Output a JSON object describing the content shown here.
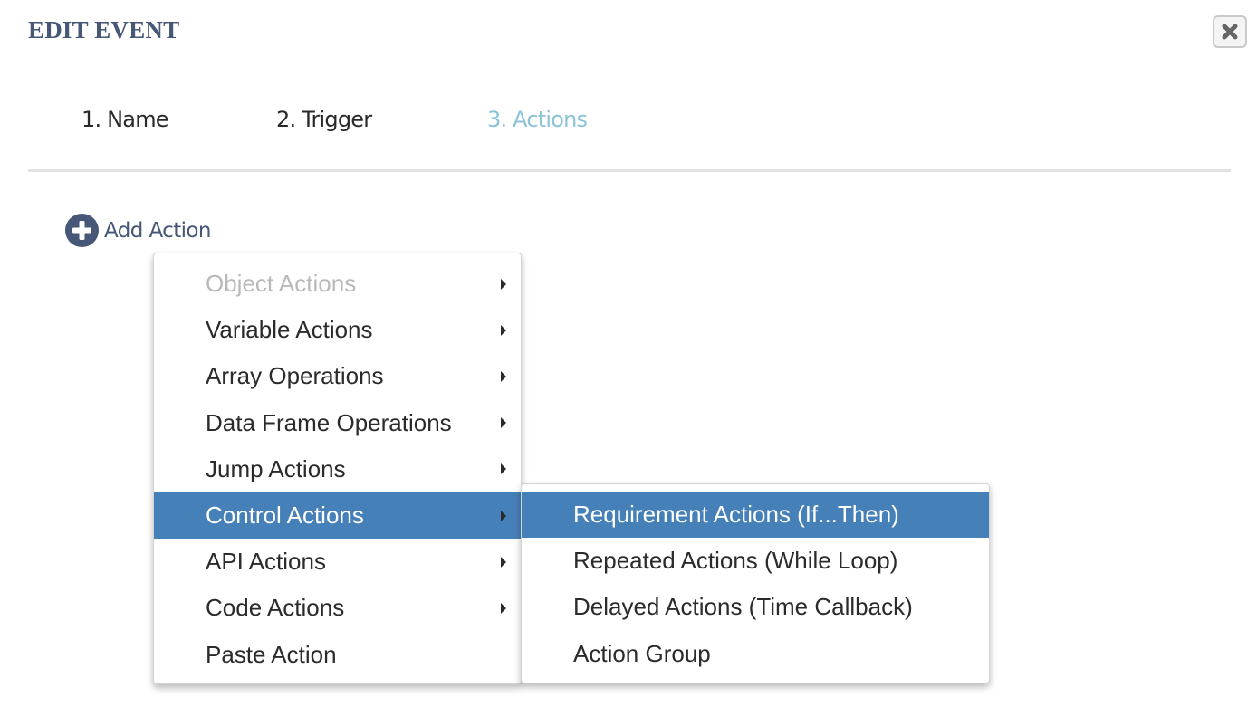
{
  "dialog": {
    "title": "EDIT EVENT",
    "close_icon": "close-x-icon"
  },
  "tabs": [
    {
      "label": "1. Name",
      "active": false
    },
    {
      "label": "2. Trigger",
      "active": false
    },
    {
      "label": "3. Actions",
      "active": true
    }
  ],
  "add_action": {
    "icon": "plus-circle-icon",
    "label": "Add Action"
  },
  "menu": {
    "items": [
      {
        "label": "Object Actions",
        "submenu": true,
        "disabled": true,
        "highlighted": false
      },
      {
        "label": "Variable Actions",
        "submenu": true,
        "disabled": false,
        "highlighted": false
      },
      {
        "label": "Array Operations",
        "submenu": true,
        "disabled": false,
        "highlighted": false
      },
      {
        "label": "Data Frame Operations",
        "submenu": true,
        "disabled": false,
        "highlighted": false
      },
      {
        "label": "Jump Actions",
        "submenu": true,
        "disabled": false,
        "highlighted": false
      },
      {
        "label": "Control Actions",
        "submenu": true,
        "disabled": false,
        "highlighted": true
      },
      {
        "label": "API Actions",
        "submenu": true,
        "disabled": false,
        "highlighted": false
      },
      {
        "label": "Code Actions",
        "submenu": true,
        "disabled": false,
        "highlighted": false
      },
      {
        "label": "Paste Action",
        "submenu": false,
        "disabled": false,
        "highlighted": false
      }
    ]
  },
  "submenu": {
    "parent": "Control Actions",
    "items": [
      {
        "label": "Requirement Actions (If...Then)",
        "highlighted": true
      },
      {
        "label": "Repeated Actions (While Loop)",
        "highlighted": false
      },
      {
        "label": "Delayed Actions (Time Callback)",
        "highlighted": false
      },
      {
        "label": "Action Group",
        "highlighted": false
      }
    ]
  },
  "colors": {
    "title": "#465778",
    "active_tab": "#8cc3d9",
    "highlight": "#4580b8",
    "disabled_text": "#b9b9b9"
  }
}
